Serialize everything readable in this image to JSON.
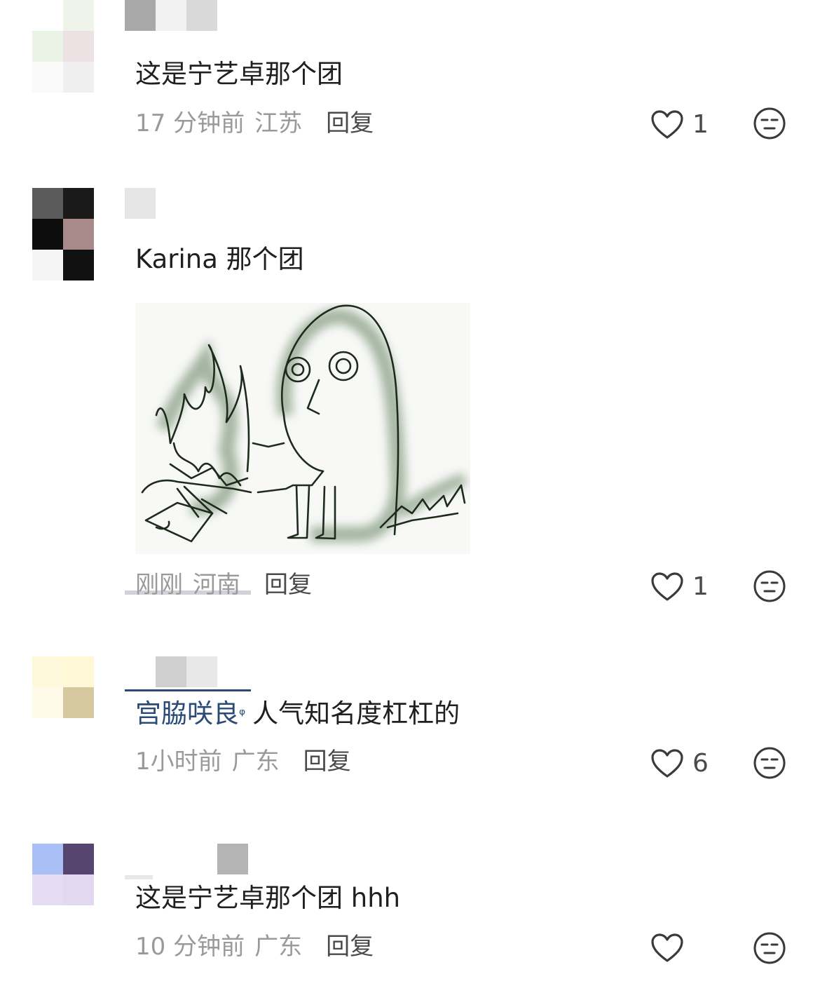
{
  "comments": [
    {
      "text": "这是宁艺卓那个团",
      "time": "17 分钟前",
      "location": "江苏",
      "reply_label": "回复",
      "like_count": "1"
    },
    {
      "text": "Karina 那个团",
      "time": "刚刚",
      "location": "河南",
      "reply_label": "回复",
      "like_count": "1",
      "has_sticker": true
    },
    {
      "mention": "宫脇咲良",
      "text": "人气知名度杠杠的",
      "time": "1小时前",
      "location": "广东",
      "reply_label": "回复",
      "like_count": "6"
    },
    {
      "text": "这是宁艺卓那个团 hhh",
      "time": "10 分钟前",
      "location": "广东",
      "reply_label": "回复",
      "like_count": ""
    }
  ],
  "icons": {
    "like": "heart-outline-icon",
    "dislike": "unimpressed-face-icon",
    "mention": "search-magnifier-icon"
  },
  "colors": {
    "text": "#1f1f1f",
    "meta": "#9a9a9a",
    "reply": "#4a4a4a",
    "mention": "#2a4a78",
    "icon": "#3a3a3a"
  }
}
